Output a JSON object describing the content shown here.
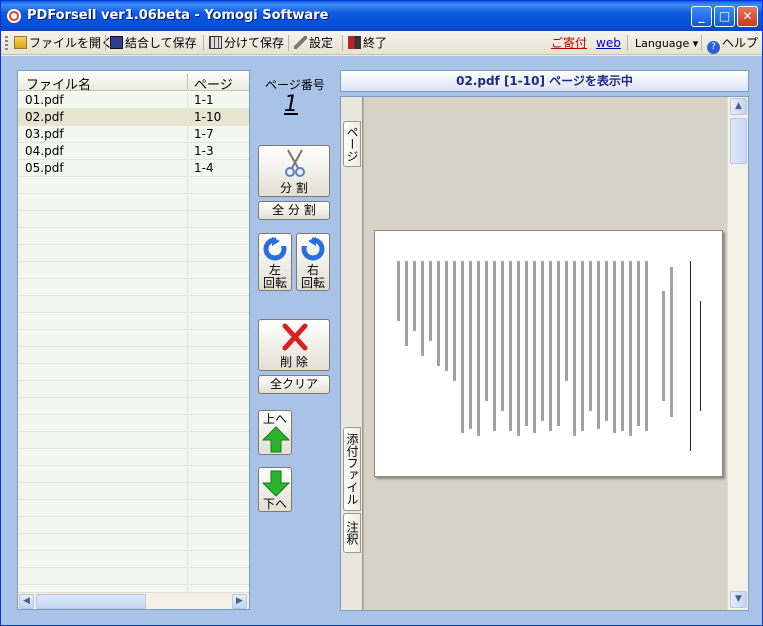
{
  "window": {
    "title": "PDForsell ver1.06beta - Yomogi Software"
  },
  "titlebar_buttons": {
    "minimize": "_",
    "maximize": "□",
    "close": "✕"
  },
  "toolbar": {
    "open": "ファイルを開く",
    "merge_save": "結合して保存",
    "split_save": "分けて保存",
    "settings": "設定",
    "exit": "終了",
    "donate": "ご寄付",
    "web": "web",
    "language": "Language ▾",
    "help": "ヘルプ"
  },
  "filelist": {
    "headers": {
      "name": "ファイル名",
      "pages": "ページ"
    },
    "rows": [
      {
        "name": "01.pdf",
        "pages": "1-1"
      },
      {
        "name": "02.pdf",
        "pages": "1-10"
      },
      {
        "name": "03.pdf",
        "pages": "1-7"
      },
      {
        "name": "04.pdf",
        "pages": "1-3"
      },
      {
        "name": "05.pdf",
        "pages": "1-4"
      }
    ],
    "selected_index": 1
  },
  "page_number": {
    "label": "ページ番号",
    "value": "1"
  },
  "side_buttons": {
    "split": "分 割",
    "split_all": "全 分 割",
    "rotate_left_1": "左",
    "rotate_left_2": "回転",
    "rotate_right_1": "右",
    "rotate_right_2": "回転",
    "delete": "削 除",
    "clear_all": "全クリア",
    "move_up": "上へ",
    "move_down": "下へ"
  },
  "preview": {
    "header": "02.pdf [1-10] ページを表示中",
    "tabs": {
      "page": "ページ",
      "attachment": "添付ファイル",
      "annotation": "注釈"
    }
  },
  "colors": {
    "accent": "#0a5fe8",
    "panel": "#a8c2e8",
    "header_text": "#1a2a8a"
  }
}
